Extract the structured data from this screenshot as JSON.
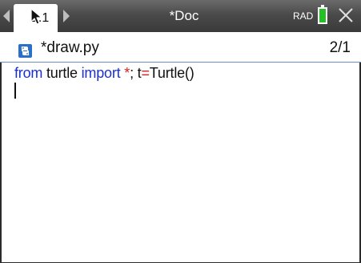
{
  "topbar": {
    "tab_label": "1.1",
    "doc_title": "*Doc",
    "angle_mode": "RAD"
  },
  "file": {
    "name": "*draw.py",
    "page_count": "2/1"
  },
  "editor": {
    "line1": {
      "kw_from": "from",
      "mod_text": " turtle ",
      "kw_import": "import",
      "space": " ",
      "star": "*",
      "semi": "; t",
      "eq": "=",
      "call": "Turtle()"
    }
  },
  "colors": {
    "keyword": "#1a2fd8",
    "operator": "#d22020",
    "battery": "#25c025",
    "divider": "#6a8fbe",
    "titlebar": "#4a4a4a"
  },
  "icons": [
    "nav-left-icon",
    "nav-right-icon",
    "battery-icon",
    "close-icon",
    "python-file-icon",
    "mouse-pointer-icon"
  ]
}
